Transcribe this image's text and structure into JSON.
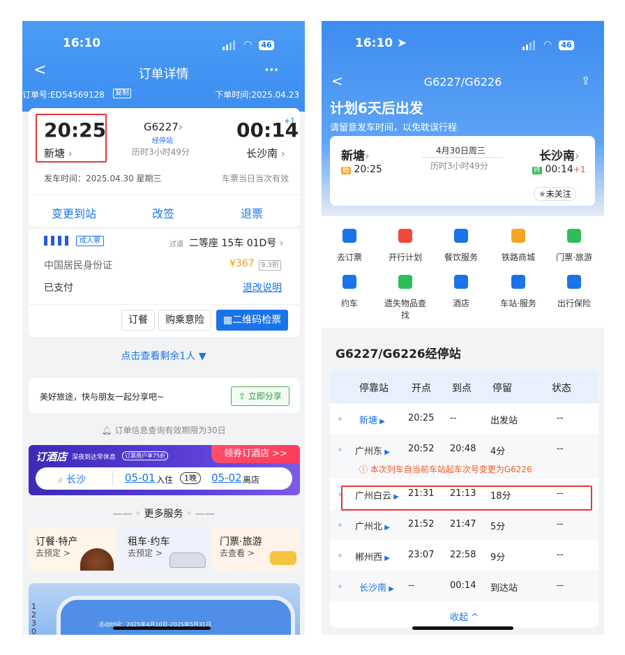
{
  "left": {
    "status": {
      "time": "16:10",
      "battery": "46"
    },
    "nav": {
      "back": "<",
      "title": "订单详情",
      "more": "···"
    },
    "order_line": {
      "number": "订单号:ED54569128",
      "copy": "复制",
      "order_time": "下单时间:2025.04.23"
    },
    "trip": {
      "dep_time": "20:25",
      "dep_station": "新塘",
      "train": "G6227",
      "stop_badge": "经停站",
      "duration": "历时3小时49分",
      "arr_time": "00:14",
      "arr_plus": "+1",
      "arr_station": "长沙南",
      "depart_date": "发车时间：2025.04.30 星期三",
      "validity": "车票当日当次有效"
    },
    "actions": {
      "change_station": "变更到站",
      "reschedule": "改签",
      "refund": "退票"
    },
    "passenger": {
      "ticket_type": "成人票",
      "pass_tag": "过道",
      "seat": "二等座 15车 01D号",
      "id_type": "中国居民身份证",
      "price": "¥367",
      "discount": "9.3折",
      "paid": "已支付",
      "refund_note": "退改说明"
    },
    "buttons": {
      "meal": "订餐",
      "insurance": "购乘意险",
      "qr": "二维码检票"
    },
    "expand": "点击查看剩余1人",
    "share": {
      "text": "美好旅途，快与朋友一起分享吧~",
      "button": "立即分享"
    },
    "notice": "订单信息查询有效期限为30日",
    "hotel": {
      "logo": "订酒店",
      "slogan": "深夜到达早休息",
      "promo_badge": "订票用户享75折",
      "coupon": "领券订酒店 >>",
      "city": "长沙",
      "checkin": "05-01",
      "checkin_label": "入住",
      "nights": "1晚",
      "checkout": "05-02",
      "checkout_label": "离店"
    },
    "more_services": "更多服务",
    "service_cards": [
      {
        "title": "订餐·特产",
        "sub": "去预定 >"
      },
      {
        "title": "租车·约车",
        "sub": "去预定 >"
      },
      {
        "title": "门票·旅游",
        "sub": "去查看 >"
      }
    ],
    "bottom_banner": {
      "vertical": "1230",
      "date_text": "活动时间：2025年4月10日-2025年5月31日"
    }
  },
  "right": {
    "status": {
      "time": "16:10",
      "battery": "46"
    },
    "nav": {
      "back": "<",
      "title": "G6227/G6226"
    },
    "headline": "计划6天后出发",
    "subline": "请留意发车时间，以免耽误行程",
    "trip": {
      "dep_station": "新塘",
      "start_badge": "始",
      "dep_time": "20:25",
      "date": "4月30日周三",
      "duration": "历时3小时49分",
      "arr_station": "长沙南",
      "end_badge": "终",
      "arr_time": "00:14",
      "arr_plus": "+1",
      "follow": "未关注"
    },
    "services": [
      {
        "label": "去订票",
        "icon": "train-ticket-icon",
        "color": "#1a73e8"
      },
      {
        "label": "开行计划",
        "icon": "calendar-icon",
        "color": "#f0483e"
      },
      {
        "label": "餐饮服务",
        "icon": "cutlery-icon",
        "color": "#1a73e8"
      },
      {
        "label": "铁路商城",
        "icon": "shop-icon",
        "color": "#f5a623"
      },
      {
        "label": "门票·旅游",
        "icon": "mountain-icon",
        "color": "#2ebd59"
      },
      {
        "label": "约车",
        "icon": "car-icon",
        "color": "#1a73e8"
      },
      {
        "label": "遗失物品查找",
        "icon": "lost-bag-icon",
        "color": "#2ebd59"
      },
      {
        "label": "酒店",
        "icon": "hotel-icon",
        "color": "#1a73e8"
      },
      {
        "label": "车站·服务",
        "icon": "station-icon",
        "color": "#1a73e8"
      },
      {
        "label": "出行保险",
        "icon": "insurance-icon",
        "color": "#1a73e8"
      }
    ],
    "stops_title": "G6227/G6226经停站",
    "table_headers": [
      "停靠站",
      "开点",
      "到点",
      "停留",
      "状态"
    ],
    "stops": [
      {
        "station": "新塘",
        "dep": "20:25",
        "arr": "--",
        "stay": "出发站",
        "status": "--"
      },
      {
        "station": "广州东",
        "dep": "20:52",
        "arr": "20:48",
        "stay": "4分",
        "status": "--"
      },
      {
        "station": "广州白云",
        "dep": "21:31",
        "arr": "21:13",
        "stay": "18分",
        "status": "--"
      },
      {
        "station": "广州北",
        "dep": "21:52",
        "arr": "21:47",
        "stay": "5分",
        "status": "--"
      },
      {
        "station": "郴州西",
        "dep": "23:07",
        "arr": "22:58",
        "stay": "9分",
        "status": "--"
      },
      {
        "station": "长沙南",
        "dep": "--",
        "arr": "00:14",
        "stay": "到达站",
        "status": "--"
      }
    ],
    "change_notice": "本次列车自当前车站起车次号变更为G6226",
    "collapse": "收起 ^"
  }
}
